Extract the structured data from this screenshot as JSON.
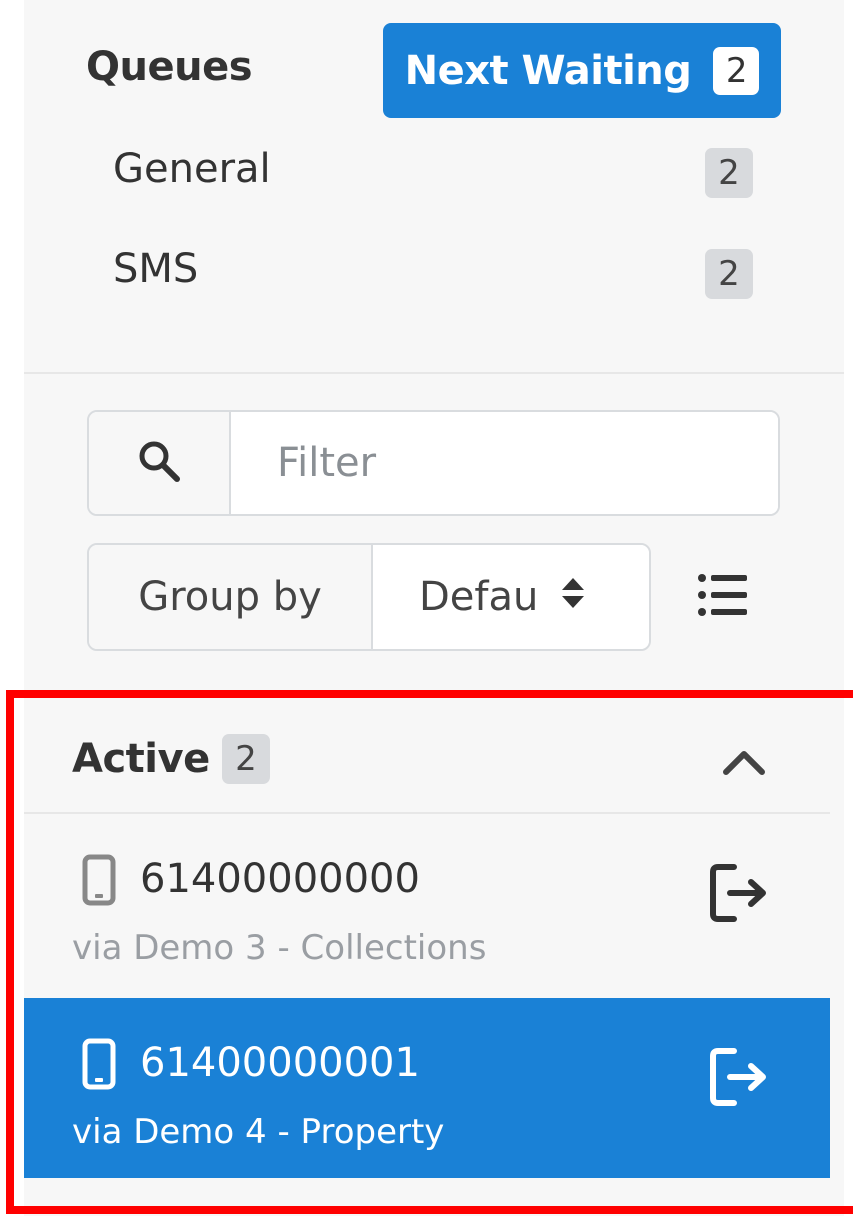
{
  "queues": {
    "title": "Queues",
    "next_button": {
      "label": "Next Waiting",
      "count": "2"
    },
    "items": [
      {
        "label": "General",
        "count": "2"
      },
      {
        "label": "SMS",
        "count": "2"
      }
    ]
  },
  "filter": {
    "placeholder": "Filter",
    "icon": "search-icon"
  },
  "group_by": {
    "label": "Group by",
    "value": "Defau",
    "icon": "sort-icon"
  },
  "view_toggle": {
    "icon": "list-icon"
  },
  "active": {
    "title": "Active",
    "count": "2",
    "collapse_icon": "chevron-up-icon",
    "conversations": [
      {
        "number": "61400000000",
        "via": "via Demo 3 - Collections",
        "selected": false
      },
      {
        "number": "61400000001",
        "via": "via Demo 4 - Property",
        "selected": true
      }
    ]
  },
  "colors": {
    "accent": "#1a81d6",
    "highlight_border": "#ff0000",
    "badge_bg": "#d8dadd"
  }
}
